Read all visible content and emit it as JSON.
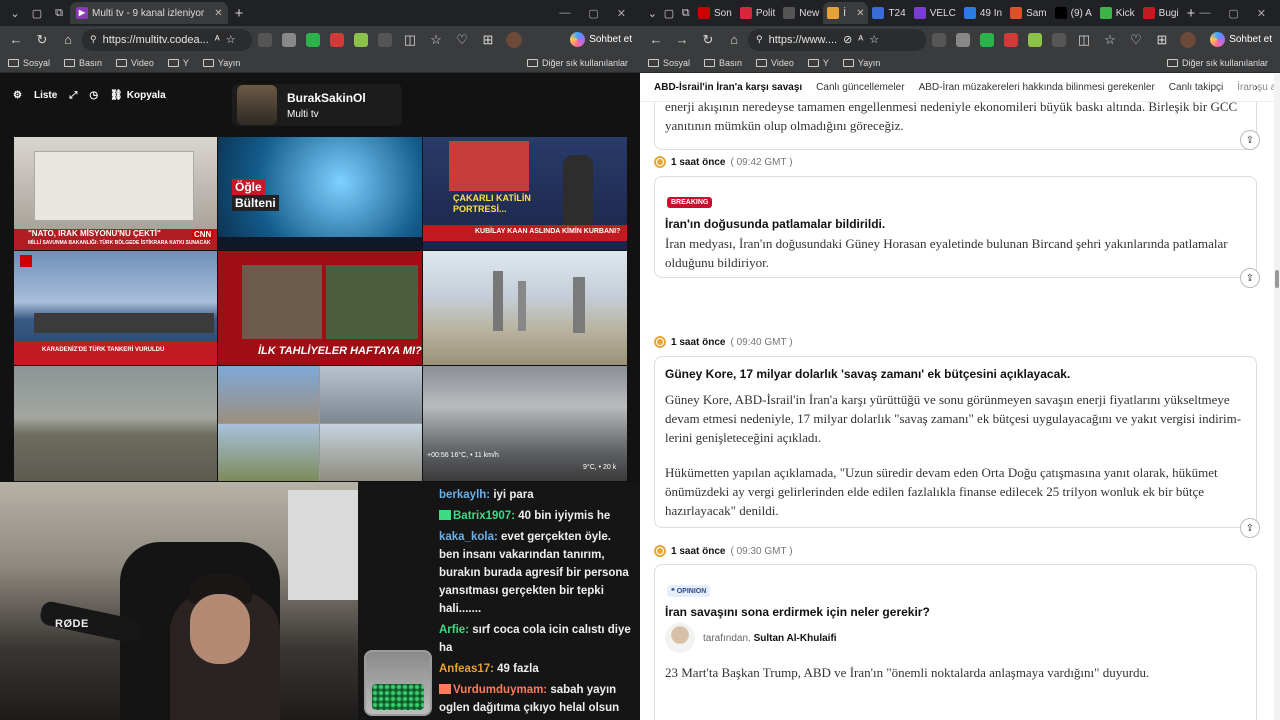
{
  "left": {
    "tabs": [
      {
        "label": "Multi tv - 9 kanal izleniyor",
        "favicon_color": "#8a3ab9"
      }
    ],
    "address": "https://multitv.codea...",
    "bookmarks": [
      "Sosyal",
      "Basın",
      "Video",
      "Y",
      "Yayın"
    ],
    "bookmarks_other": "Diğer sık kullanılanlar",
    "copilot": "Sohbet et",
    "toolbar": {
      "list": "Liste",
      "copy": "Kopyala"
    },
    "channel": {
      "name": "BurakSakinOl",
      "subtitle": "Multi tv"
    },
    "overlays": {
      "c1_headline": "\"NATO, IRAK MİSYONU'NU ÇEKTİ\"",
      "c1_sub": "MİLLİ SAVUNMA BAKANLIĞI: TÜRK BÖLGEDE İSTİKRARA KATKI SUNACAK",
      "c1_brand": "CNN",
      "c2_tag1": "Öğle",
      "c2_tag2": "Bülteni",
      "c3_headline1": "ÇAKARLI KATİLİN",
      "c3_headline2": "PORTRESİ...",
      "c3_bar": "KUBİLAY KAAN ASLINDA KİMİN KURBANI?",
      "c4_headline": "KARADENİZ'DE TÜRK TANKERİ VURULDU",
      "c5_headline": "İLK TAHLİYELER HAFTAYA MI?",
      "c9_weather": "+00:56   16°C, • 11 km/h",
      "c9_weather2": "9°C, • 20 k"
    }
  },
  "right": {
    "tabs": [
      "Son",
      "Polit",
      "New",
      "İ",
      "T24",
      "VELC",
      "49 In",
      "Sam",
      "(9) A",
      "Kick",
      "Bugi"
    ],
    "address": "https://www....",
    "copilot": "Sohbet et",
    "bookmarks": [
      "Sosyal",
      "Basın",
      "Video",
      "Y",
      "Yayın"
    ],
    "bookmarks_other": "Diğer sık kullanılanlar",
    "nav": [
      "ABD-İsrail'in İran'a karşı savaşı",
      "Canlı güncellemeler",
      "ABD-İran müzakereleri hakkında bilinmesi gerekenler",
      "Canlı takipçi",
      "İran şu anda dah"
    ],
    "top_card_text1": "enerji akışının neredeyse tamamen engellenmesi nedeniyle ekonomileri büyük baskı altında. Birleşik bir GCC",
    "top_card_text2": "yanıtının mümkün olup olmadığını göreceğiz.",
    "posts": [
      {
        "ago": "1 saat önce",
        "time": "( 09:42 GMT )",
        "tag": "BREAKING",
        "title": "İran'ın doğusunda patlamalar bildirildi.",
        "body": "İran medyası, İran'ın doğusundaki Güney Horasan eyaletinde bulunan Bircand şehri yakınlarında patlamalar olduğunu bildiriyor."
      },
      {
        "ago": "1 saat önce",
        "time": "( 09:40 GMT )",
        "title": "Güney Kore, 17 milyar dolarlık 'savaş zamanı' ek bütçesini açıklayacak.",
        "body": "Güney Kore, ABD-İsrail'in İran'a karşı yürüttüğü ve sonu görünmeyen savaşın enerji fiyatlarını yükseltmeye devam etmesi nedeniyle, 17 milyar dolarlık \"savaş zamanı\" ek bütçesi uygulayacağını ve yakıt vergisi indirim-lerini genişleteceğini açıkladı.",
        "body2": "Hükümetten yapılan açıklamada, \"Uzun süredir devam eden Orta Doğu çatışmasına yanıt olarak, hükümet önümüzdeki ay vergi gelirlerinden elde edilen fazlalıkla finanse edilecek 25 trilyon wonluk ek bir bütçe hazırlayacak\" denildi."
      },
      {
        "ago": "1 saat önce",
        "time": "( 09:30 GMT )",
        "tag": "❝ OPINION",
        "title": "İran savaşını sona erdirmek için neler gerekir?",
        "byline": "tarafından.",
        "author": "Sultan Al-Khulaifi",
        "body": "23 Mart'ta Başkan Trump, ABD ve İran'ın \"önemli noktalarda anlaşmaya vardığını\" duyurdu."
      }
    ]
  },
  "chat": [
    {
      "user": "berkaylh:",
      "text": " iyi para",
      "color": "#6ab0e8"
    },
    {
      "user": "Batrix1907:",
      "text": " 40 bin iyiymis he",
      "color": "#3ddc84",
      "badge": true
    },
    {
      "user": "kaka_kola:",
      "text": " evet gerçekten öyle. ben insanı vakarından tanırım, burakın burada agresif bir persona yansıtması gerçekten bir tepki hali.......",
      "color": "#6ab0e8"
    },
    {
      "user": "Arfie:",
      "text": " sırf coca cola icin calıstı diye ha",
      "color": "#3ddc84"
    },
    {
      "user": "Anfeas17:",
      "text": " 49 fazla",
      "color": "#e8a03a"
    },
    {
      "user": "Vurdumduymam:",
      "text": " sabah yayın oglen dağıtıma çıkıyo helal olsun",
      "color": "#ff7b5a",
      "badge": true
    }
  ],
  "cam": {
    "mic_brand": "RØDE"
  }
}
